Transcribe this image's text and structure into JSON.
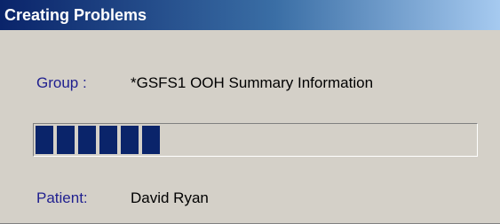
{
  "window": {
    "title": "Creating Problems"
  },
  "fields": {
    "group_label": "Group :",
    "group_value": "*GSFS1 OOH Summary Information",
    "patient_label": "Patient:",
    "patient_value": "David Ryan"
  },
  "progress": {
    "fraction": 0.29
  },
  "colors": {
    "titlebar_start": "#0a246a",
    "titlebar_end": "#a6caf0",
    "label_blue": "#1f1f8f",
    "progress_block": "#0a246a",
    "face": "#d4d0c8"
  }
}
